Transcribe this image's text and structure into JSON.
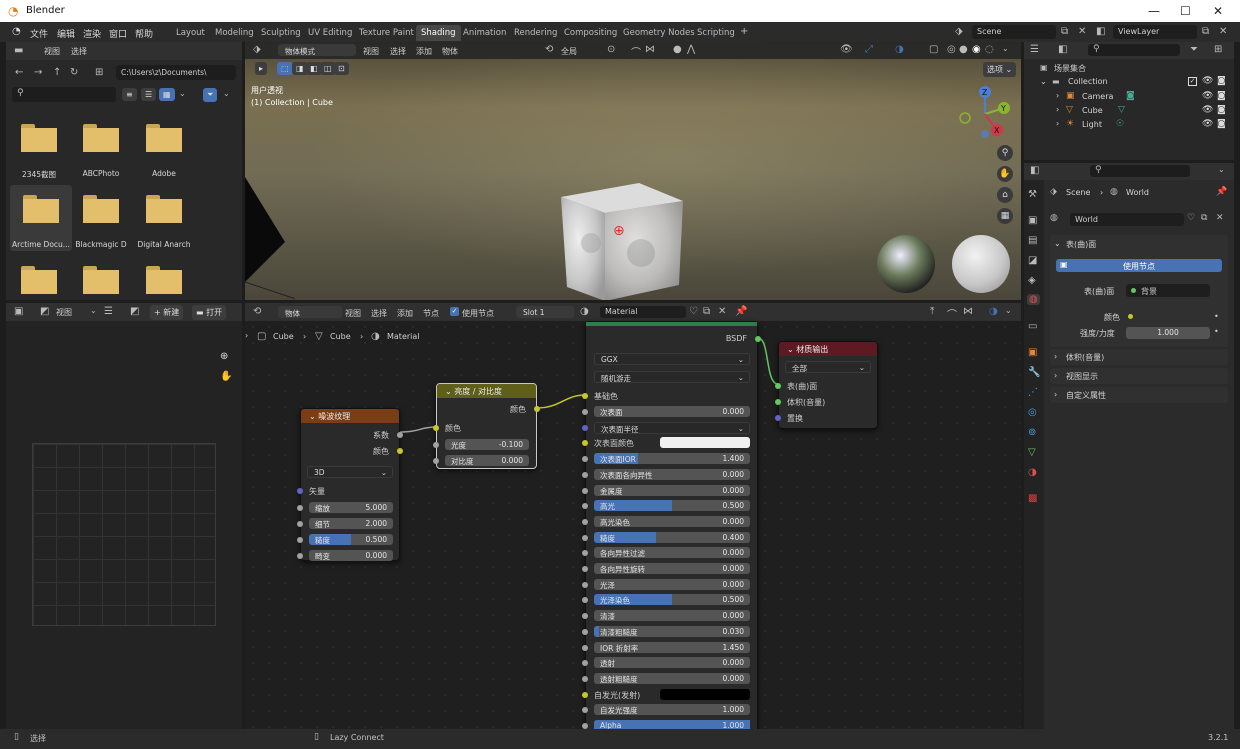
{
  "app": {
    "title": "Blender",
    "version": "3.2.1"
  },
  "menu": [
    "文件",
    "编辑",
    "渲染",
    "窗口",
    "帮助"
  ],
  "workspaces": [
    "Layout",
    "Modeling",
    "Sculpting",
    "UV Editing",
    "Texture Paint",
    "Shading",
    "Animation",
    "Rendering",
    "Compositing",
    "Geometry Nodes",
    "Scripting"
  ],
  "active_workspace": "Shading",
  "scene": {
    "name": "Scene",
    "view_layer": "ViewLayer"
  },
  "file_browser": {
    "menus": [
      "视图",
      "选择"
    ],
    "path": "C:\\Users\\z\\Documents\\",
    "folders": [
      "2345截图",
      "ABCPhoto",
      "Adobe",
      "Arctime Docu...",
      "Blackmagic D",
      "Digital Anarch",
      "",
      "",
      ""
    ]
  },
  "image_editor": {
    "view": "视图",
    "new": "新建",
    "open": "打开"
  },
  "viewport": {
    "mode": "物体模式",
    "menus": [
      "视图",
      "选择",
      "添加",
      "物体"
    ],
    "transform": "全局",
    "options": "选项",
    "info_line1": "用户透视",
    "info_line2": "(1) Collection | Cube"
  },
  "node_editor": {
    "type": "物体",
    "menus": [
      "视图",
      "选择",
      "添加",
      "节点"
    ],
    "use_nodes": "使用节点",
    "slot": "Slot 1",
    "material": "Material",
    "breadcrumb": [
      "Cube",
      "Cube",
      "Material"
    ]
  },
  "nodes": {
    "noise": {
      "title": "噪波纹理",
      "out1": "系数",
      "out2": "颜色",
      "dim": "3D",
      "vector": "矢量",
      "fields": [
        {
          "label": "缩放",
          "value": "5.000",
          "fill": 0
        },
        {
          "label": "细节",
          "value": "2.000",
          "fill": 0
        },
        {
          "label": "糙度",
          "value": "0.500",
          "fill": 0.5
        },
        {
          "label": "畸变",
          "value": "0.000",
          "fill": 0
        }
      ]
    },
    "bc": {
      "title": "亮度 / 对比度",
      "out": "颜色",
      "in": "颜色",
      "fields": [
        {
          "label": "光度",
          "value": "-0.100"
        },
        {
          "label": "对比度",
          "value": "0.000"
        }
      ]
    },
    "bsdf": {
      "out": "BSDF",
      "dist": "GGX",
      "sss": "随机游走",
      "base": "基础色",
      "rows": [
        {
          "label": "次表面",
          "value": "0.000",
          "fill": 0,
          "type": "field"
        },
        {
          "label": "次表面半径",
          "value": "",
          "fill": 0,
          "type": "dd"
        },
        {
          "label": "次表面颜色",
          "value": "",
          "fill": 0,
          "type": "color"
        },
        {
          "label": "次表面IOR",
          "value": "1.400",
          "fill": 0.28,
          "type": "field"
        },
        {
          "label": "次表面各向异性",
          "value": "0.000",
          "fill": 0,
          "type": "field"
        },
        {
          "label": "金属度",
          "value": "0.000",
          "fill": 0,
          "type": "field"
        },
        {
          "label": "高光",
          "value": "0.500",
          "fill": 0.5,
          "type": "field"
        },
        {
          "label": "高光染色",
          "value": "0.000",
          "fill": 0,
          "type": "field"
        },
        {
          "label": "糙度",
          "value": "0.400",
          "fill": 0.4,
          "type": "field"
        },
        {
          "label": "各向异性过滤",
          "value": "0.000",
          "fill": 0,
          "type": "field"
        },
        {
          "label": "各向异性旋转",
          "value": "0.000",
          "fill": 0,
          "type": "field"
        },
        {
          "label": "光泽",
          "value": "0.000",
          "fill": 0,
          "type": "field"
        },
        {
          "label": "光泽染色",
          "value": "0.500",
          "fill": 0.5,
          "type": "field"
        },
        {
          "label": "清漆",
          "value": "0.000",
          "fill": 0,
          "type": "field"
        },
        {
          "label": "清漆粗糙度",
          "value": "0.030",
          "fill": 0.03,
          "type": "field"
        },
        {
          "label": "IOR 折射率",
          "value": "1.450",
          "fill": 0,
          "type": "field"
        },
        {
          "label": "透射",
          "value": "0.000",
          "fill": 0,
          "type": "field"
        },
        {
          "label": "透射粗糙度",
          "value": "0.000",
          "fill": 0,
          "type": "field"
        },
        {
          "label": "自发光(发射)",
          "value": "",
          "fill": 0,
          "type": "black"
        },
        {
          "label": "自发光强度",
          "value": "1.000",
          "fill": 0,
          "type": "field"
        },
        {
          "label": "Alpha",
          "value": "1.000",
          "fill": 1,
          "type": "field"
        }
      ]
    },
    "output": {
      "title": "材质输出",
      "target": "全部",
      "in1": "表(曲)面",
      "in2": "体积(音量)",
      "in3": "置换"
    }
  },
  "outliner": {
    "root": "场景集合",
    "collection": "Collection",
    "items": [
      "Camera",
      "Cube",
      "Light"
    ]
  },
  "properties": {
    "breadcrumb": [
      "Scene",
      "World"
    ],
    "world": "World",
    "surface_header": "表(曲)面",
    "use_nodes": "使用节点",
    "surface_label": "表(曲)面",
    "surface_value": "背景",
    "color_label": "颜色",
    "strength_label": "强度/力度",
    "strength_value": "1.000",
    "sections": [
      "体积(音量)",
      "视图显示",
      "自定义属性"
    ]
  },
  "status": {
    "left": "选择",
    "mid": "Lazy Connect"
  },
  "colors": {
    "accent": "#4772b3",
    "noise_header": "#7a3d15",
    "bc_header": "#5f5f1a",
    "output_header": "#5d1a22"
  }
}
